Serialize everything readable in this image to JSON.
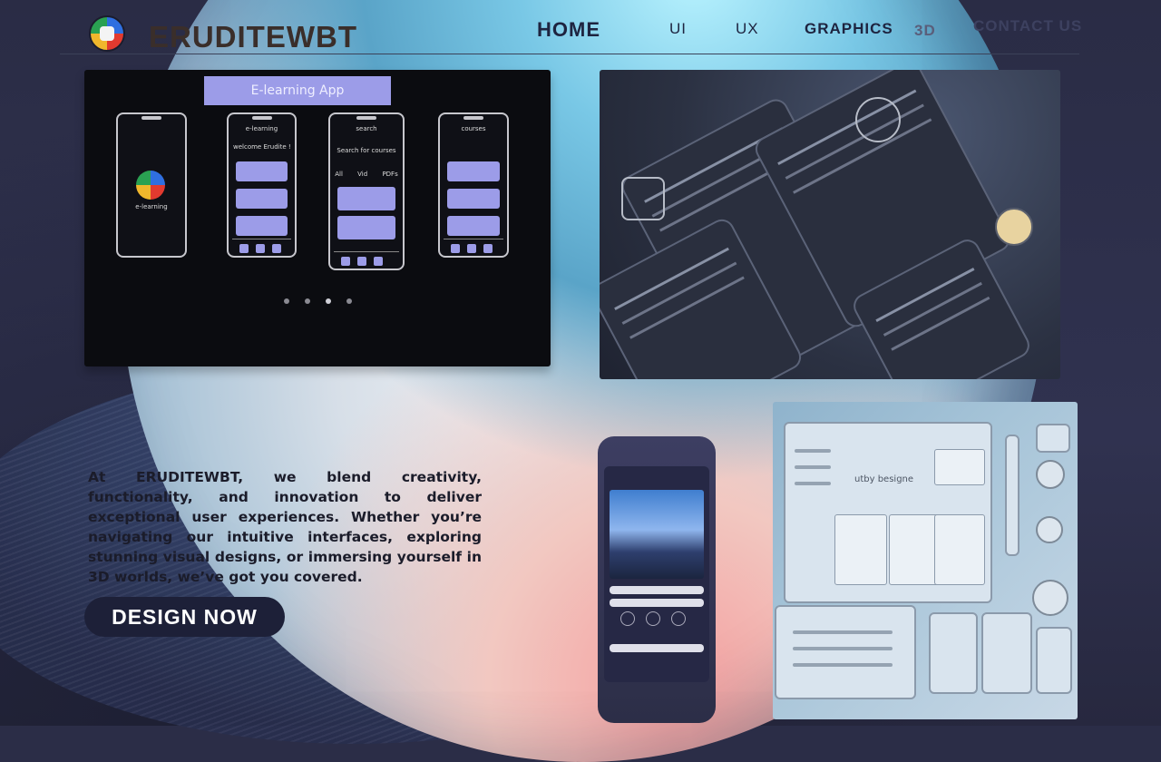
{
  "brand": {
    "name": "ERUDITEWBT"
  },
  "nav": {
    "home": "HOME",
    "ui": "UI",
    "ux": "UX",
    "graphics": "GRAPHICS",
    "three_d": "3D",
    "contact": "CONTACT US"
  },
  "showcase": {
    "carousel_title": "E-learning App",
    "phones": [
      {
        "title": "",
        "label": "e-learning"
      },
      {
        "title": "e-learning",
        "label": "welcome Erudite !"
      },
      {
        "title": "search",
        "label": "Search for courses",
        "tabs": [
          "All",
          "Vid",
          "PDFs"
        ]
      },
      {
        "title": "courses",
        "label": ""
      }
    ],
    "carousel_dots": 4,
    "active_dot": 3,
    "board_title": "utby besigne"
  },
  "hero": {
    "description": "At ERUDITEWBT, we blend creativity, functionality, and innovation to deliver exceptional user experiences. Whether you’re navigating our intuitive interfaces, exploring stunning visual designs, or immersing yourself in 3D worlds, we’ve got you covered.",
    "cta": "DESIGN NOW"
  },
  "colors": {
    "accent": "#9c9ce8",
    "cta_bg": "#1d2038",
    "text_dark": "#1b1c2a"
  }
}
